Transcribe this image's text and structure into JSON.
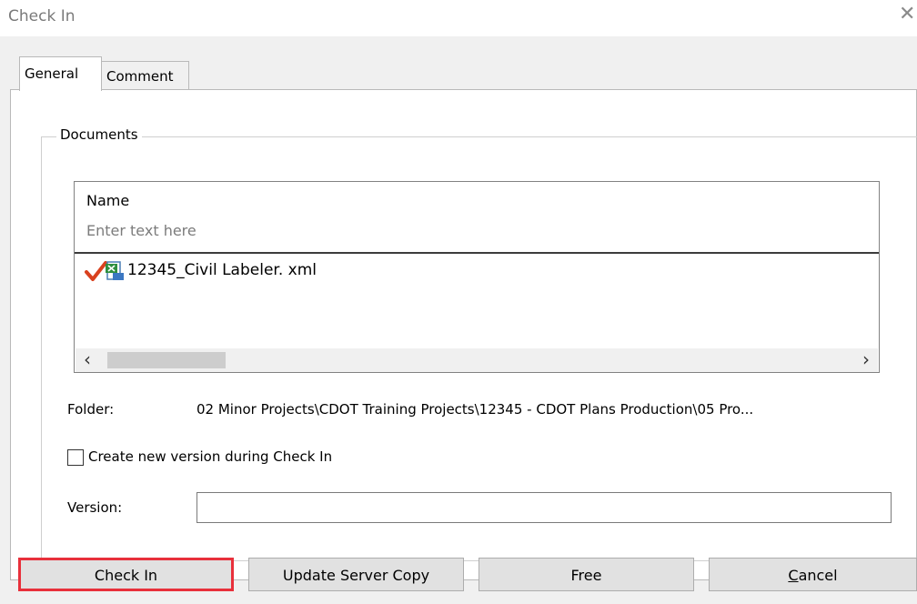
{
  "window": {
    "title": "Check In",
    "close_icon": "close-icon"
  },
  "tabs": [
    {
      "label": "General",
      "active": true
    },
    {
      "label": "Comment",
      "active": false
    }
  ],
  "documents": {
    "group_label": "Documents",
    "column_header": "Name",
    "filter_placeholder": "Enter text here",
    "rows": [
      {
        "name": "12345_Civil Labeler. xml",
        "status_icon": "checkmark-icon",
        "type_icon": "xml-file-icon"
      }
    ],
    "scroll_left": "‹",
    "scroll_right": "›"
  },
  "folder": {
    "label": "Folder:",
    "value": "02 Minor Projects\\CDOT Training Projects\\12345 - CDOT Plans Production\\05 Pro..."
  },
  "create_version": {
    "label": "Create new version during Check In",
    "checked": false
  },
  "version": {
    "label": "Version:",
    "value": ""
  },
  "buttons": {
    "check_in": "Check In",
    "update_server_copy": "Update Server Copy",
    "free": "Free",
    "cancel_first": "C",
    "cancel_rest": "ancel"
  },
  "colors": {
    "highlight": "#e8303b",
    "checkmark": "#d9411e"
  }
}
